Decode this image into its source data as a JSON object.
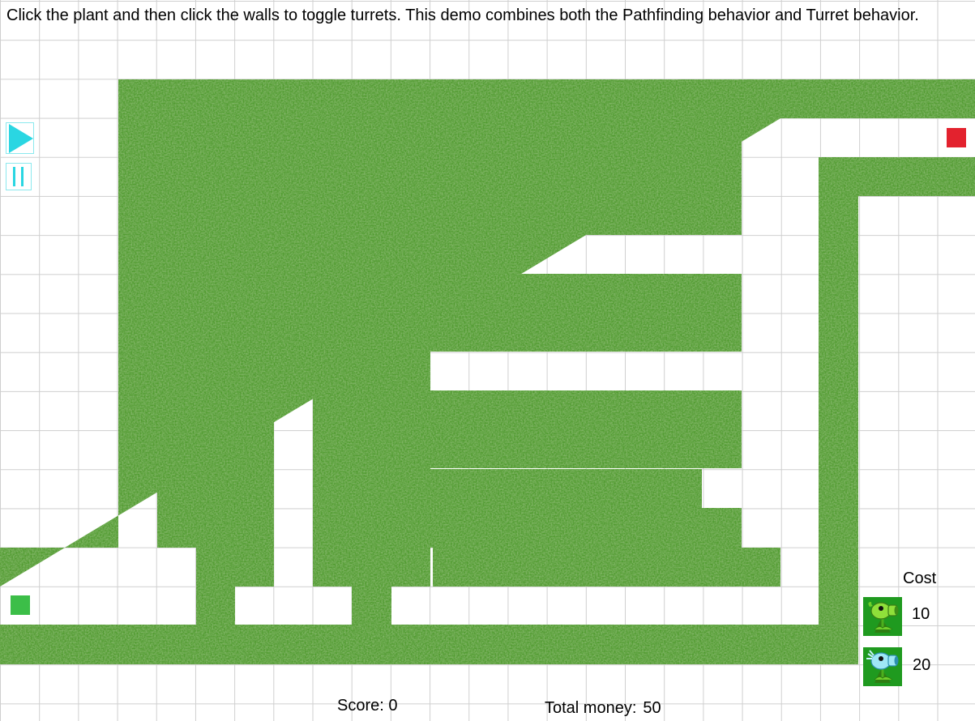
{
  "instructions": "Click the plant and then click the walls to toggle turrets.  This demo combines both the Pathfinding behavior and Turret behavior.",
  "controls": {
    "play_icon": "play-icon",
    "pause_icon": "pause-icon"
  },
  "markers": {
    "start_color": "#3cbe48",
    "end_color": "#e3222e"
  },
  "colors": {
    "grass": "#4f9a2e",
    "grid": "#cfcfcf",
    "control_cyan": "#2ad6e2"
  },
  "shop": {
    "cost_label": "Cost",
    "items": [
      {
        "name": "peashooter-plant-icon",
        "cost": "10"
      },
      {
        "name": "snow-pea-plant-icon",
        "cost": "20"
      }
    ]
  },
  "status": {
    "score_label": "Score:",
    "score_value": "0",
    "money_label": "Total money:",
    "money_value": "50"
  }
}
